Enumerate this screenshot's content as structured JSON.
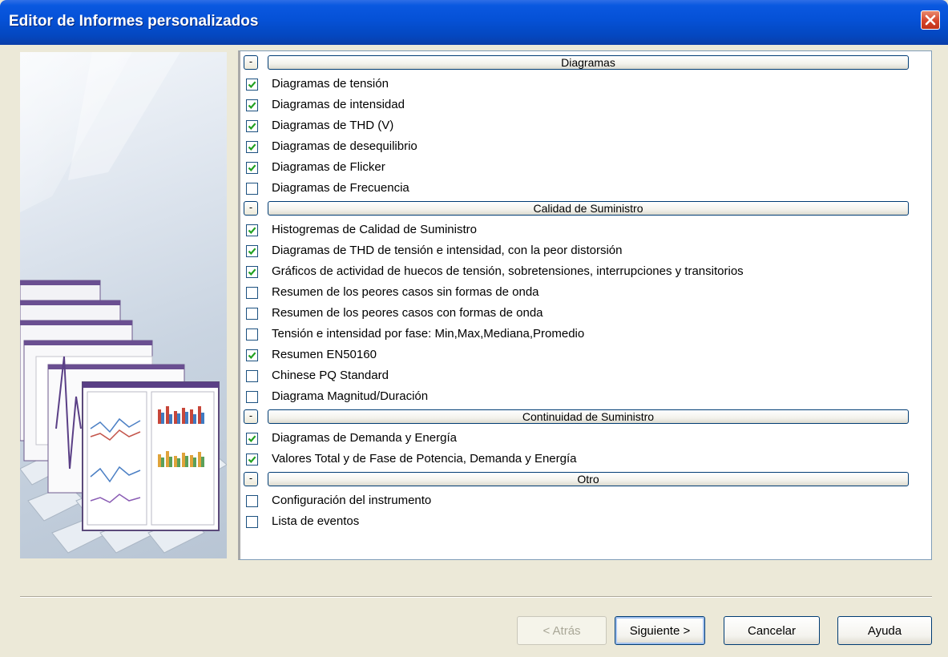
{
  "window": {
    "title": "Editor de Informes personalizados",
    "close_icon": "close-icon"
  },
  "sections": [
    {
      "collapse_label": "-",
      "title": "Diagramas",
      "items": [
        {
          "label": "Diagramas de tensión",
          "checked": true
        },
        {
          "label": "Diagramas de intensidad",
          "checked": true
        },
        {
          "label": "Diagramas de THD (V)",
          "checked": true
        },
        {
          "label": "Diagramas de desequilibrio",
          "checked": true
        },
        {
          "label": "Diagramas de Flicker",
          "checked": true
        },
        {
          "label": "Diagramas de Frecuencia",
          "checked": false
        }
      ]
    },
    {
      "collapse_label": "-",
      "title": "Calidad de Suministro",
      "items": [
        {
          "label": "Histogremas de Calidad de Suministro",
          "checked": true
        },
        {
          "label": "Diagramas de THD de tensión e intensidad, con la peor distorsión",
          "checked": true
        },
        {
          "label": "Gráficos de actividad de huecos de tensión, sobretensiones, interrupciones y transitorios",
          "checked": true
        },
        {
          "label": "Resumen de los peores casos sin formas de onda",
          "checked": false
        },
        {
          "label": "Resumen de los peores casos con formas de onda",
          "checked": false
        },
        {
          "label": "Tensión e intensidad por fase: Min,Max,Mediana,Promedio",
          "checked": false
        },
        {
          "label": "Resumen EN50160",
          "checked": true
        },
        {
          "label": "Chinese PQ Standard",
          "checked": false
        },
        {
          "label": "Diagrama Magnitud/Duración",
          "checked": false
        }
      ]
    },
    {
      "collapse_label": "-",
      "title": "Continuidad de Suministro",
      "items": [
        {
          "label": "Diagramas de Demanda y Energía",
          "checked": true
        },
        {
          "label": "Valores Total y de Fase de Potencia, Demanda y Energía",
          "checked": true
        }
      ]
    },
    {
      "collapse_label": "-",
      "title": "Otro",
      "items": [
        {
          "label": "Configuración del instrumento",
          "checked": false
        },
        {
          "label": "Lista de eventos",
          "checked": false
        }
      ]
    }
  ],
  "buttons": {
    "back": {
      "label": "< Atrás",
      "enabled": false
    },
    "next": {
      "label": "Siguiente >",
      "enabled": true
    },
    "cancel": {
      "label": "Cancelar",
      "enabled": true
    },
    "help": {
      "label": "Ayuda",
      "enabled": true
    }
  },
  "colors": {
    "titlebar": "#0551d6",
    "check": "#21a121",
    "dialog_bg": "#ece9d8"
  }
}
